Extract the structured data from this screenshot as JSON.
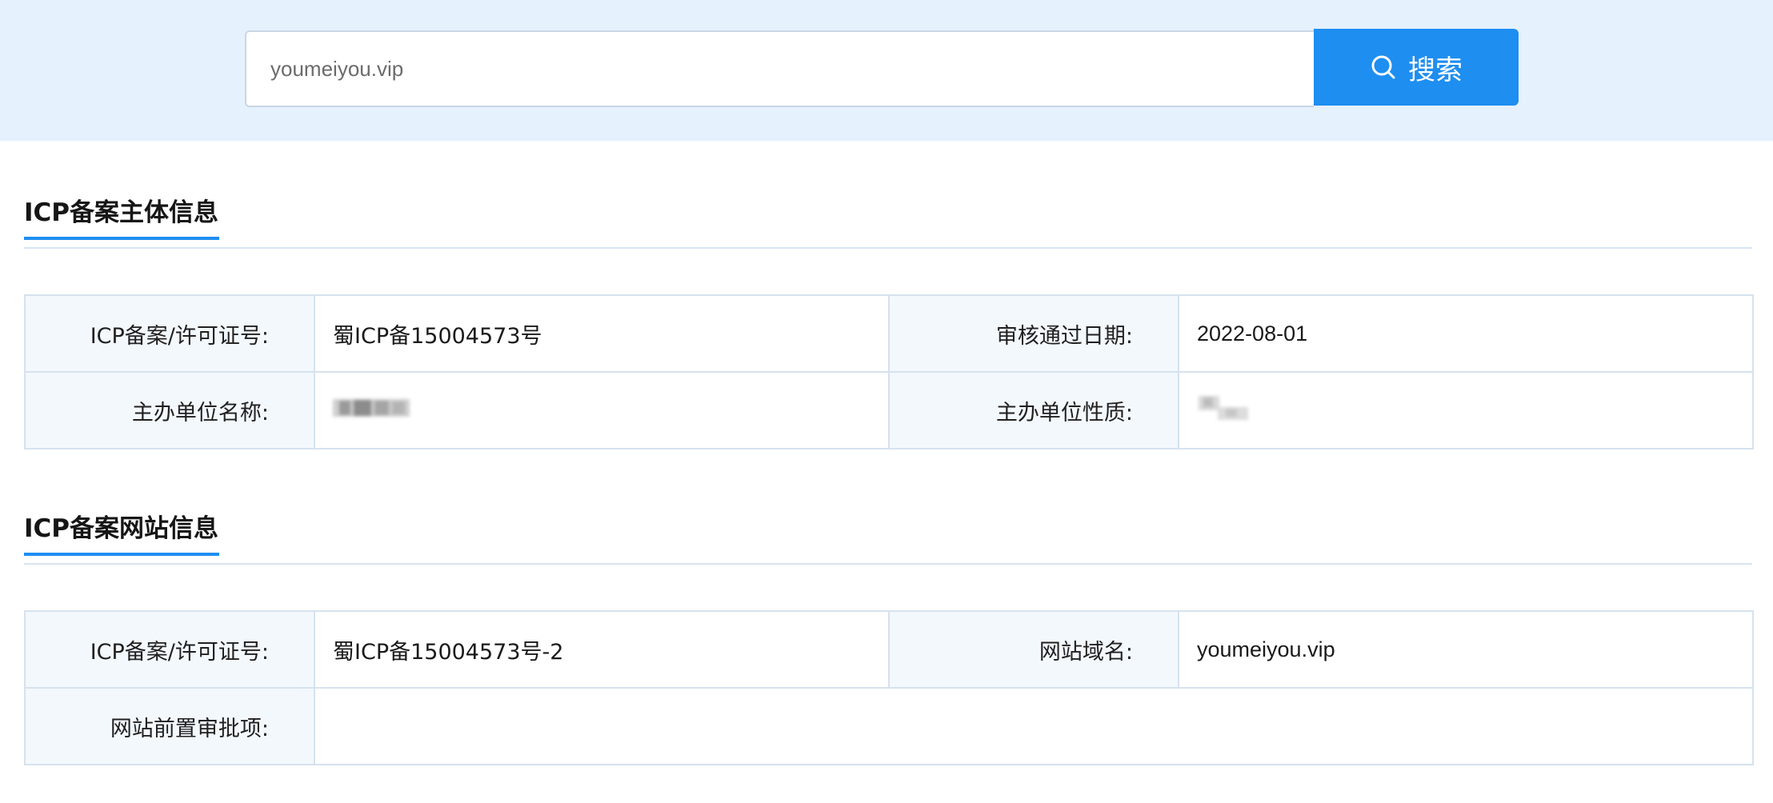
{
  "search": {
    "placeholder": "youmeiyou.vip",
    "button_label": "搜索"
  },
  "subject_section": {
    "title": "ICP备案主体信息",
    "rows": [
      {
        "label1": "ICP备案/许可证号:",
        "value1": "蜀ICP备15004573号",
        "label2": "审核通过日期:",
        "value2": "2022-08-01"
      },
      {
        "label1": "主办单位名称:",
        "label2": "主办单位性质:"
      }
    ]
  },
  "website_section": {
    "title": "ICP备案网站信息",
    "rows": [
      {
        "label1": "ICP备案/许可证号:",
        "value1": "蜀ICP备15004573号-2",
        "label2": "网站域名:",
        "value2": "youmeiyou.vip"
      },
      {
        "label1": "网站前置审批项:",
        "value1": ""
      }
    ]
  },
  "colors": {
    "accent": "#1e8ef1",
    "top_band": "#e5f1fd",
    "label_cell": "#f3f8fd",
    "border": "#d6e2ee"
  },
  "icons": {
    "search_button_icon": "search-icon"
  }
}
